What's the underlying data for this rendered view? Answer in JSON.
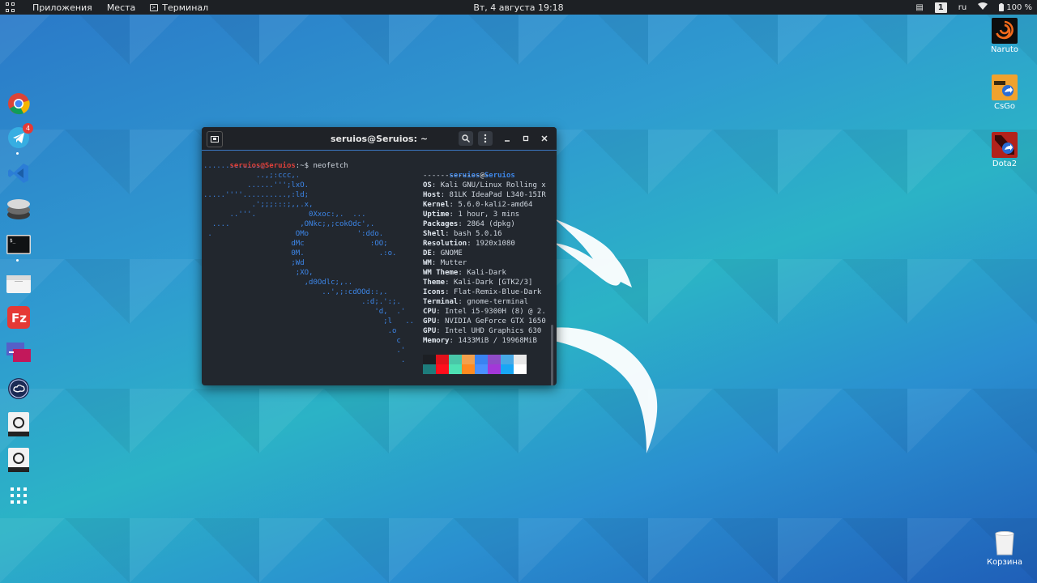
{
  "topbar": {
    "applications": "Приложения",
    "places": "Места",
    "terminal": "Терминал",
    "datetime": "Вт, 4 августа  19:18",
    "workspace": "1",
    "language": "ru",
    "battery": "100 %"
  },
  "desktop": {
    "icons": [
      {
        "label": "Naruto"
      },
      {
        "label": "CsGo"
      },
      {
        "label": "Dota2"
      },
      {
        "label": "Корзина"
      }
    ]
  },
  "dock": {
    "telegram_badge": "4"
  },
  "terminal": {
    "title": "seruios@Seruios: ~",
    "prompt_user": "seruios@Seruios",
    "prompt_path": ":~$ ",
    "command": "neofetch",
    "ascii": [
      "..............",
      "            ..,;:ccc,.",
      "          ......''';lxO.",
      ".....''''..........,:ld;",
      "           .';;;:::;,,.x,",
      "      ..'''.            0Xxoc:,.  ...",
      "  ....                ,ONkc;,;cokOdc',.",
      " .                   OMo           ':ddo.",
      "                    dMc               :OO;",
      "                    0M.                 .:o.",
      "                    ;Wd",
      "                     ;XO,",
      "                       ,d0Odlc;,..",
      "                           ..',;:cdOOd::,.",
      "                                    .:d;.':;.",
      "                                       'd,  .'",
      "                                         ;l   ..",
      "                                          .o",
      "                                            c",
      "                                            .'",
      "                                             ."
    ],
    "info_user": "seruios",
    "info_at": "@",
    "info_host": "Seruios",
    "separator": "---------------",
    "info": [
      {
        "key": "OS",
        "value": "Kali GNU/Linux Rolling x"
      },
      {
        "key": "Host",
        "value": "81LK IdeaPad L340-15IR"
      },
      {
        "key": "Kernel",
        "value": "5.6.0-kali2-amd64"
      },
      {
        "key": "Uptime",
        "value": "1 hour, 3 mins"
      },
      {
        "key": "Packages",
        "value": "2864 (dpkg)"
      },
      {
        "key": "Shell",
        "value": "bash 5.0.16"
      },
      {
        "key": "Resolution",
        "value": "1920x1080"
      },
      {
        "key": "DE",
        "value": "GNOME"
      },
      {
        "key": "WM",
        "value": "Mutter"
      },
      {
        "key": "WM Theme",
        "value": "Kali-Dark"
      },
      {
        "key": "Theme",
        "value": "Kali-Dark [GTK2/3]"
      },
      {
        "key": "Icons",
        "value": "Flat-Remix-Blue-Dark"
      },
      {
        "key": "Terminal",
        "value": "gnome-terminal"
      },
      {
        "key": "CPU",
        "value": "Intel i5-9300H (8) @ 2."
      },
      {
        "key": "GPU",
        "value": "NVIDIA GeForce GTX 1650"
      },
      {
        "key": "GPU",
        "value": "Intel UHD Graphics 630"
      },
      {
        "key": "Memory",
        "value": "1433MiB / 19968MiB"
      }
    ],
    "palette_top": [
      "#1c1f24",
      "#e0111a",
      "#49c6a8",
      "#f3a04c",
      "#3a83f1",
      "#8f4cc6",
      "#47a9e6",
      "#e8e8e8"
    ],
    "palette_bottom": [
      "#1d7c7c",
      "#ff0e1c",
      "#4ee0b3",
      "#ff8a1f",
      "#4a90ff",
      "#a338d8",
      "#18a6f5",
      "#ffffff"
    ]
  }
}
